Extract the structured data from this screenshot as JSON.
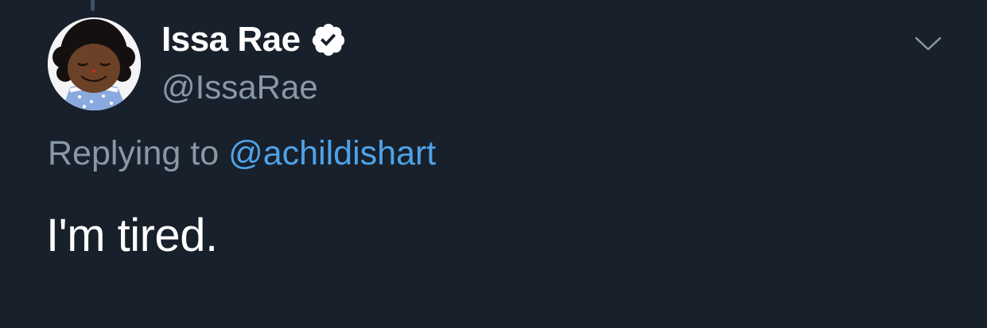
{
  "tweet": {
    "author": {
      "display_name": "Issa Rae",
      "handle": "@IssaRae",
      "verified": true,
      "avatar_icon": "avatar-doll-image"
    },
    "reply": {
      "label": "Replying to",
      "mention": "@achildishart"
    },
    "text": "I'm tired.",
    "menu_icon": "chevron-down-icon"
  },
  "colors": {
    "background": "#18202b",
    "primary_text": "#ffffff",
    "secondary_text": "#8899a6",
    "link": "#4ea3e8"
  }
}
